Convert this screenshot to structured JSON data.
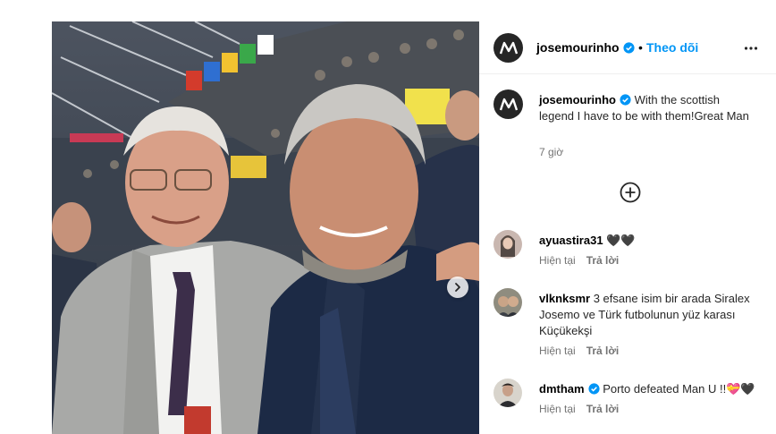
{
  "post": {
    "author": "josemourinho",
    "follow_label": "Theo dõi",
    "separator": "•",
    "caption_text": "With the scottish legend I have to be with them!Great Man",
    "time_ago": "7 giờ"
  },
  "comments": [
    {
      "username": "ayuastira31",
      "text": "🖤🖤",
      "time_ago": "Hiện tại",
      "reply_label": "Trả lời"
    },
    {
      "username": "vlknksmr",
      "text": "3 efsane isim bir arada Siralex Josemo ve Türk futbolunun yüz karası Küçükekşi",
      "time_ago": "Hiện tại",
      "reply_label": "Trả lời"
    },
    {
      "username": "dmtham",
      "text": "Porto defeated Man U !!💝🖤",
      "time_ago": "Hiện tại",
      "reply_label": "Trả lời"
    }
  ],
  "icons": {
    "verified": "verified-badge-icon",
    "more": "more-options-icon",
    "load_more": "plus-circle-icon",
    "next": "chevron-right-icon"
  },
  "colors": {
    "follow": "#0095f6",
    "verified": "#0095f6",
    "muted": "#737373"
  }
}
